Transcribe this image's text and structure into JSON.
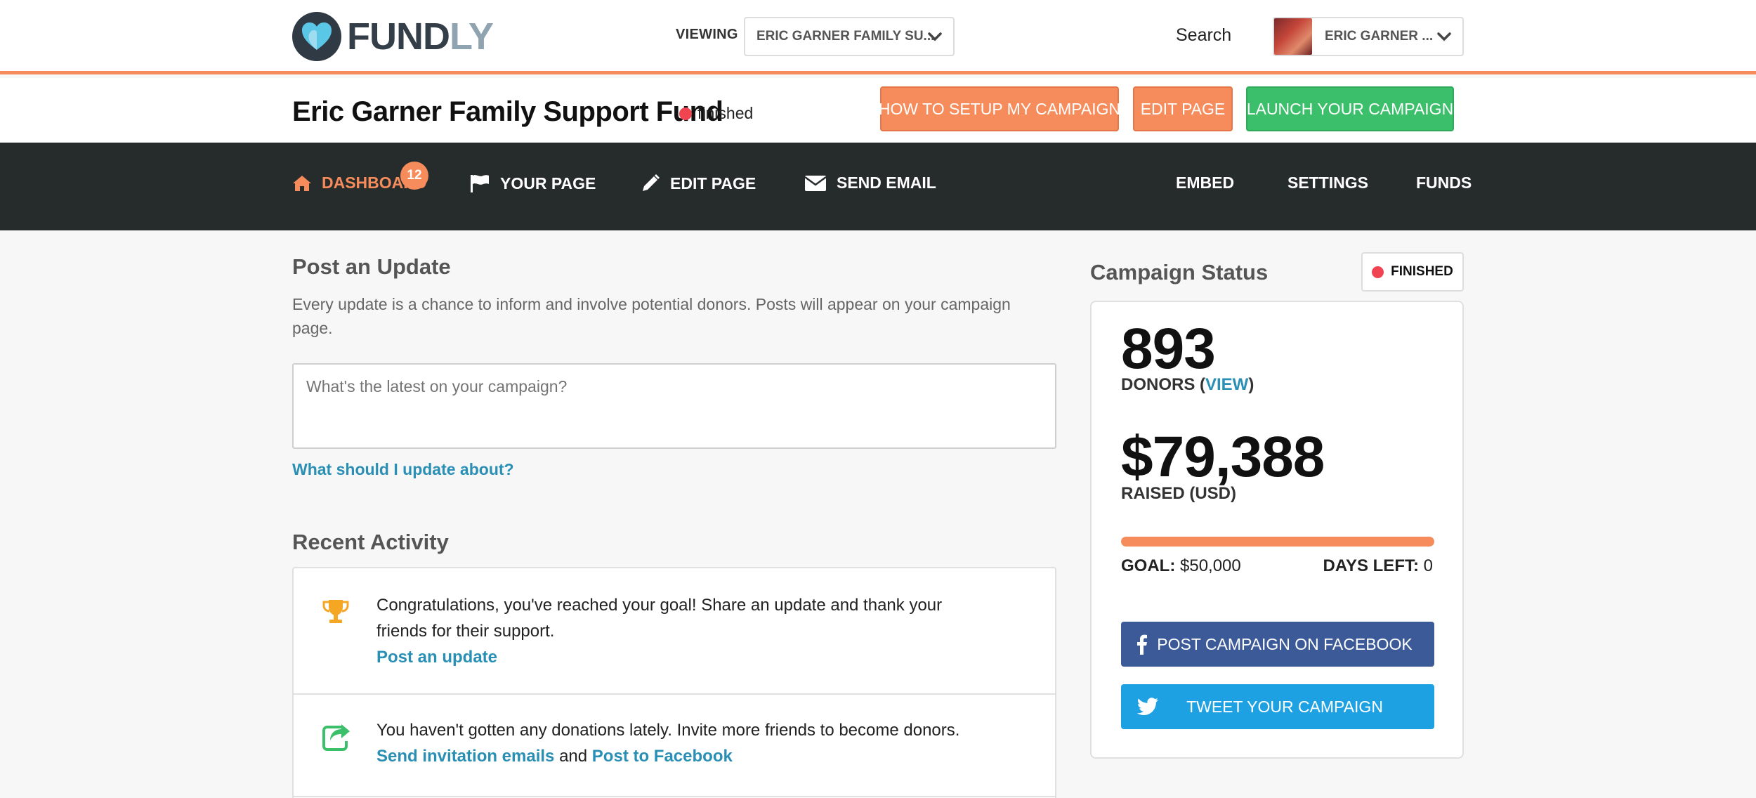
{
  "brand": {
    "name_dark": "FUND",
    "name_light": "LY",
    "colors": {
      "accent": "#f68c5b",
      "green": "#3cbf6a",
      "link": "#2a8fb5",
      "nav_bg": "#262b2c",
      "status_red": "#f04450",
      "facebook": "#3d5a98",
      "twitter": "#1da1e2"
    }
  },
  "topbar": {
    "viewing_label": "VIEWING",
    "viewing_value": "ERIC GARNER FAMILY SU...",
    "search_label": "Search",
    "user_name": "ERIC GARNER ..."
  },
  "campaign": {
    "title": "Eric Garner Family Support Fund",
    "status": "finished",
    "buttons": {
      "setup": "HOW TO SETUP MY CAMPAIGN",
      "edit": "EDIT PAGE",
      "launch": "LAUNCH YOUR CAMPAIGN"
    }
  },
  "nav": {
    "items": [
      {
        "label": "DASHBOARD",
        "icon": "home-icon"
      },
      {
        "label": "YOUR PAGE",
        "icon": "flag-icon"
      },
      {
        "label": "EDIT PAGE",
        "icon": "pencil-icon"
      },
      {
        "label": "SEND EMAIL",
        "icon": "envelope-icon"
      },
      {
        "label": "EMBED"
      },
      {
        "label": "SETTINGS"
      },
      {
        "label": "FUNDS"
      }
    ],
    "dashboard_badge": "12"
  },
  "update": {
    "heading": "Post an Update",
    "description": "Every update is a chance to inform and involve potential donors. Posts will appear on your campaign page.",
    "placeholder": "What's the latest on your campaign?",
    "help_link": "What should I update about?"
  },
  "activity": {
    "heading": "Recent Activity",
    "items": [
      {
        "icon": "trophy-icon",
        "text": "Congratulations, you've reached your goal! Share an update and thank your friends for their support.",
        "link": "Post an update"
      },
      {
        "icon": "share-icon",
        "text": "You haven't gotten any donations lately. Invite more friends to become donors.",
        "link_1": "Send invitation emails",
        "joiner": "and",
        "link_2": "Post to Facebook"
      }
    ]
  },
  "status_panel": {
    "heading": "Campaign Status",
    "badge": "FINISHED",
    "donors_count": "893",
    "donors_label": "DONORS (",
    "donors_view": "VIEW",
    "donors_close": ")",
    "raised_amount": "$79,388",
    "raised_label": "RAISED (USD)",
    "progress_fraction": 1.0,
    "goal_label": "GOAL:",
    "goal_value": "$50,000",
    "days_label": "DAYS LEFT:",
    "days_value": "0",
    "facebook_button": "POST CAMPAIGN ON FACEBOOK",
    "twitter_button": "TWEET YOUR CAMPAIGN"
  }
}
